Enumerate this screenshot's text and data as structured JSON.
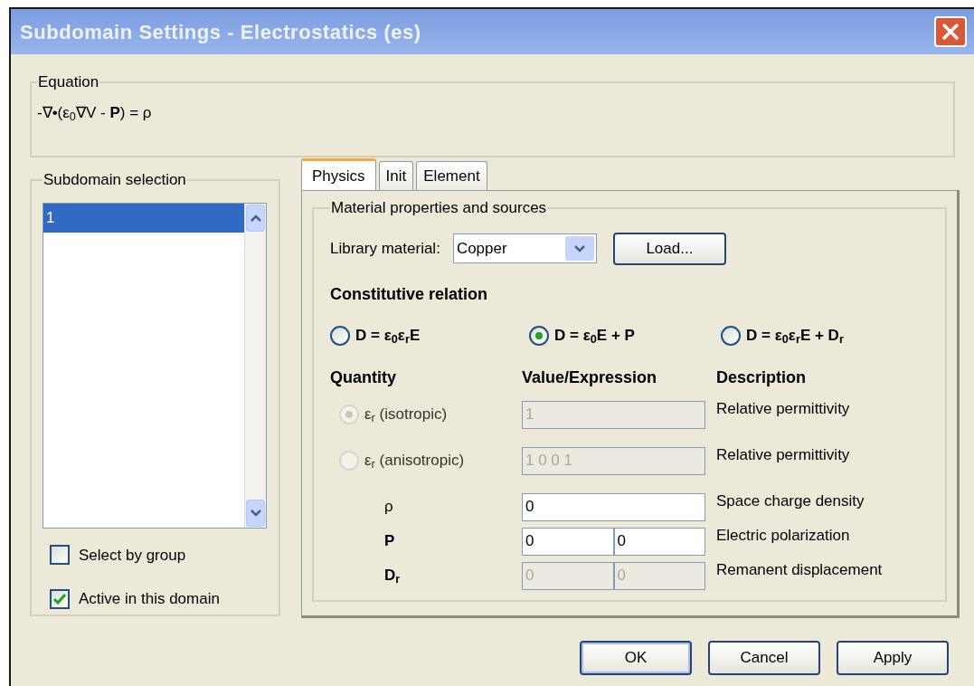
{
  "window": {
    "title": "Subdomain Settings - Electrostatics (es)"
  },
  "equation": {
    "label": "Equation",
    "formula": "-∇•(ε$_{0}$∇V - **P**) = ρ"
  },
  "subdomain_selection": {
    "label": "Subdomain selection",
    "items": [
      {
        "text": "1",
        "selected": true
      }
    ],
    "checkboxes": [
      {
        "label": "Select by group",
        "checked": false
      },
      {
        "label": "Active in this domain",
        "checked": true
      }
    ]
  },
  "tabs": [
    {
      "label": "Physics",
      "selected": true
    },
    {
      "label": "Init",
      "selected": false
    },
    {
      "label": "Element",
      "selected": false
    }
  ],
  "material": {
    "label": "Material properties and sources",
    "library_label": "Library material:",
    "library_value": "Copper",
    "load_button": "Load..."
  },
  "constitutive": {
    "heading": "Constitutive relation",
    "options": [
      {
        "label": "D = ε$_{0}$ε$_{r}$E",
        "selected": false
      },
      {
        "label": "D = ε$_{0}$E + P",
        "selected": true
      },
      {
        "label": "D = ε$_{0}$ε$_{r}$E + D$_{r}$",
        "selected": false
      }
    ]
  },
  "table": {
    "columns": [
      "Quantity",
      "Value/Expression",
      "Description"
    ],
    "rows": [
      {
        "kind": "radio",
        "quantity": "ε$_{r}$ (isotropic)",
        "selected": true,
        "disabled": true,
        "fields": [
          {
            "value": "1",
            "disabled": true
          }
        ],
        "description": "Relative permittivity"
      },
      {
        "kind": "radio",
        "quantity": "ε$_{r}$ (anisotropic)",
        "selected": false,
        "disabled": true,
        "fields": [
          {
            "value": "1 0 0 1",
            "disabled": true
          }
        ],
        "description": "Relative permittivity"
      },
      {
        "kind": "scalar",
        "quantity": "ρ",
        "fields": [
          {
            "value": "0",
            "disabled": false
          }
        ],
        "description": "Space charge density"
      },
      {
        "kind": "vector",
        "quantity": "P",
        "fields": [
          {
            "value": "0",
            "disabled": false
          },
          {
            "value": "0",
            "disabled": false
          }
        ],
        "description": "Electric polarization"
      },
      {
        "kind": "vector",
        "quantity": "D$_{r}$",
        "fields": [
          {
            "value": "0",
            "disabled": true
          },
          {
            "value": "0",
            "disabled": true
          }
        ],
        "description": "Remanent displacement"
      }
    ]
  },
  "buttons": [
    {
      "label": "OK",
      "default": true
    },
    {
      "label": "Cancel",
      "default": false
    },
    {
      "label": "Apply",
      "default": false
    }
  ]
}
